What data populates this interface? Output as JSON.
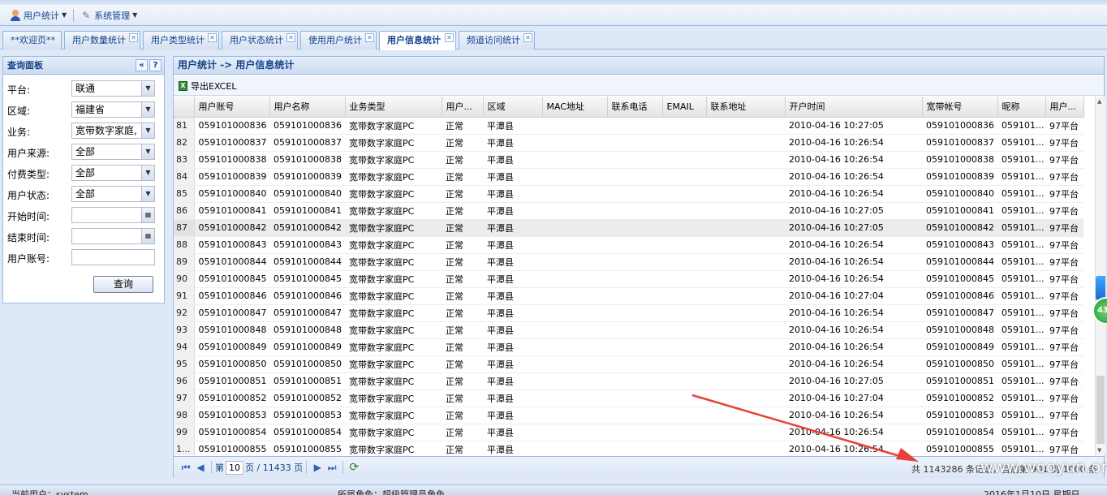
{
  "menu": {
    "user_stats": "用户统计",
    "system_manage": "系统管理"
  },
  "tabs": [
    {
      "label": "**欢迎页**",
      "closable": false,
      "active": false
    },
    {
      "label": "用户数量统计",
      "closable": true,
      "active": false
    },
    {
      "label": "用户类型统计",
      "closable": true,
      "active": false
    },
    {
      "label": "用户状态统计",
      "closable": true,
      "active": false
    },
    {
      "label": "使用用户统计",
      "closable": true,
      "active": false
    },
    {
      "label": "用户信息统计",
      "closable": true,
      "active": true
    },
    {
      "label": "频道访问统计",
      "closable": true,
      "active": false
    }
  ],
  "query_panel": {
    "title": "查询面板",
    "collapse_icon": "«",
    "help_icon": "?",
    "fields": [
      {
        "label": "平台:",
        "value": "联通",
        "type": "combo"
      },
      {
        "label": "区域:",
        "value": "福建省",
        "type": "combo"
      },
      {
        "label": "业务:",
        "value": "宽带数字家庭,",
        "type": "combo"
      },
      {
        "label": "用户来源:",
        "value": "全部",
        "type": "combo"
      },
      {
        "label": "付费类型:",
        "value": "全部",
        "type": "combo"
      },
      {
        "label": "用户状态:",
        "value": "全部",
        "type": "combo"
      },
      {
        "label": "开始时间:",
        "value": "",
        "type": "date"
      },
      {
        "label": "结束时间:",
        "value": "",
        "type": "date"
      },
      {
        "label": "用户账号:",
        "value": "",
        "type": "text"
      }
    ],
    "query_button": "查询"
  },
  "main_panel": {
    "breadcrumb": "用户统计 -> 用户信息统计",
    "export_label": "导出EXCEL",
    "columns": [
      "",
      "用户账号",
      "用户名称",
      "业务类型",
      "用户...",
      "区域",
      "MAC地址",
      "联系电话",
      "EMAIL",
      "联系地址",
      "开户时间",
      "宽带帐号",
      "昵称",
      "用户..."
    ],
    "highlighted_row": "87",
    "rows": [
      [
        "81",
        "059101000836",
        "059101000836",
        "宽带数字家庭PC",
        "正常",
        "平潭县",
        "",
        "",
        "",
        "",
        "2010-04-16 10:27:05",
        "059101000836",
        "059101...",
        "97平台"
      ],
      [
        "82",
        "059101000837",
        "059101000837",
        "宽带数字家庭PC",
        "正常",
        "平潭县",
        "",
        "",
        "",
        "",
        "2010-04-16 10:26:54",
        "059101000837",
        "059101...",
        "97平台"
      ],
      [
        "83",
        "059101000838",
        "059101000838",
        "宽带数字家庭PC",
        "正常",
        "平潭县",
        "",
        "",
        "",
        "",
        "2010-04-16 10:26:54",
        "059101000838",
        "059101...",
        "97平台"
      ],
      [
        "84",
        "059101000839",
        "059101000839",
        "宽带数字家庭PC",
        "正常",
        "平潭县",
        "",
        "",
        "",
        "",
        "2010-04-16 10:26:54",
        "059101000839",
        "059101...",
        "97平台"
      ],
      [
        "85",
        "059101000840",
        "059101000840",
        "宽带数字家庭PC",
        "正常",
        "平潭县",
        "",
        "",
        "",
        "",
        "2010-04-16 10:26:54",
        "059101000840",
        "059101...",
        "97平台"
      ],
      [
        "86",
        "059101000841",
        "059101000841",
        "宽带数字家庭PC",
        "正常",
        "平潭县",
        "",
        "",
        "",
        "",
        "2010-04-16 10:27:05",
        "059101000841",
        "059101...",
        "97平台"
      ],
      [
        "87",
        "059101000842",
        "059101000842",
        "宽带数字家庭PC",
        "正常",
        "平潭县",
        "",
        "",
        "",
        "",
        "2010-04-16 10:27:05",
        "059101000842",
        "059101...",
        "97平台"
      ],
      [
        "88",
        "059101000843",
        "059101000843",
        "宽带数字家庭PC",
        "正常",
        "平潭县",
        "",
        "",
        "",
        "",
        "2010-04-16 10:26:54",
        "059101000843",
        "059101...",
        "97平台"
      ],
      [
        "89",
        "059101000844",
        "059101000844",
        "宽带数字家庭PC",
        "正常",
        "平潭县",
        "",
        "",
        "",
        "",
        "2010-04-16 10:26:54",
        "059101000844",
        "059101...",
        "97平台"
      ],
      [
        "90",
        "059101000845",
        "059101000845",
        "宽带数字家庭PC",
        "正常",
        "平潭县",
        "",
        "",
        "",
        "",
        "2010-04-16 10:26:54",
        "059101000845",
        "059101...",
        "97平台"
      ],
      [
        "91",
        "059101000846",
        "059101000846",
        "宽带数字家庭PC",
        "正常",
        "平潭县",
        "",
        "",
        "",
        "",
        "2010-04-16 10:27:04",
        "059101000846",
        "059101...",
        "97平台"
      ],
      [
        "92",
        "059101000847",
        "059101000847",
        "宽带数字家庭PC",
        "正常",
        "平潭县",
        "",
        "",
        "",
        "",
        "2010-04-16 10:26:54",
        "059101000847",
        "059101...",
        "97平台"
      ],
      [
        "93",
        "059101000848",
        "059101000848",
        "宽带数字家庭PC",
        "正常",
        "平潭县",
        "",
        "",
        "",
        "",
        "2010-04-16 10:26:54",
        "059101000848",
        "059101...",
        "97平台"
      ],
      [
        "94",
        "059101000849",
        "059101000849",
        "宽带数字家庭PC",
        "正常",
        "平潭县",
        "",
        "",
        "",
        "",
        "2010-04-16 10:26:54",
        "059101000849",
        "059101...",
        "97平台"
      ],
      [
        "95",
        "059101000850",
        "059101000850",
        "宽带数字家庭PC",
        "正常",
        "平潭县",
        "",
        "",
        "",
        "",
        "2010-04-16 10:26:54",
        "059101000850",
        "059101...",
        "97平台"
      ],
      [
        "96",
        "059101000851",
        "059101000851",
        "宽带数字家庭PC",
        "正常",
        "平潭县",
        "",
        "",
        "",
        "",
        "2010-04-16 10:27:05",
        "059101000851",
        "059101...",
        "97平台"
      ],
      [
        "97",
        "059101000852",
        "059101000852",
        "宽带数字家庭PC",
        "正常",
        "平潭县",
        "",
        "",
        "",
        "",
        "2010-04-16 10:27:04",
        "059101000852",
        "059101...",
        "97平台"
      ],
      [
        "98",
        "059101000853",
        "059101000853",
        "宽带数字家庭PC",
        "正常",
        "平潭县",
        "",
        "",
        "",
        "",
        "2010-04-16 10:26:54",
        "059101000853",
        "059101...",
        "97平台"
      ],
      [
        "99",
        "059101000854",
        "059101000854",
        "宽带数字家庭PC",
        "正常",
        "平潭县",
        "",
        "",
        "",
        "",
        "2010-04-16 10:26:54",
        "059101000854",
        "059101...",
        "97平台"
      ],
      [
        "1...",
        "059101000855",
        "059101000855",
        "宽带数字家庭PC",
        "正常",
        "平潭县",
        "",
        "",
        "",
        "",
        "2010-04-16 10:26:54",
        "059101000855",
        "059101...",
        "97平台"
      ]
    ],
    "pager": {
      "page_prefix": "第",
      "page_value": "10",
      "page_suffix": "页 / 11433 页",
      "info": "共 1143286 条记录，目前第 901 到 1000 条"
    }
  },
  "watermark": "www.wooyun.org",
  "statusbar": {
    "current_user": "当前用户：system",
    "role": "所属角色：超级管理员角色",
    "date": "2016年1月10日 星期日"
  },
  "side_widget": {
    "badge": "43"
  },
  "colors": {
    "accent": "#15428b",
    "border": "#99bbe8",
    "arrow": "#e8403a"
  }
}
